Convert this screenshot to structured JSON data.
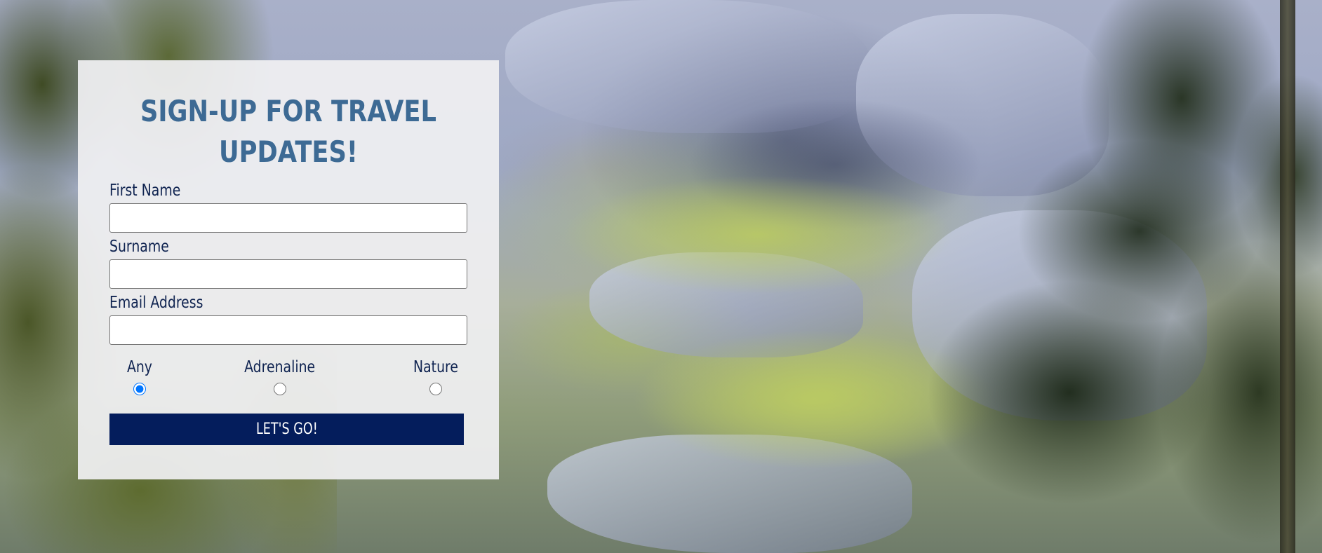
{
  "form": {
    "title": "SIGN-UP FOR TRAVEL UPDATES!",
    "fields": [
      {
        "label": "First Name",
        "value": "",
        "placeholder": ""
      },
      {
        "label": "Surname",
        "value": "",
        "placeholder": ""
      },
      {
        "label": "Email Address",
        "value": "",
        "placeholder": ""
      }
    ],
    "radio_options": [
      {
        "label": "Any",
        "checked": true
      },
      {
        "label": "Adrenaline",
        "checked": false
      },
      {
        "label": "Nature",
        "checked": false
      }
    ],
    "submit_label": "LET'S GO!"
  },
  "colors": {
    "title": "#3d6a94",
    "label": "#0f2350",
    "button_bg": "#041d5c",
    "button_text": "#ffffff",
    "card_bg": "#f0f0f2"
  }
}
